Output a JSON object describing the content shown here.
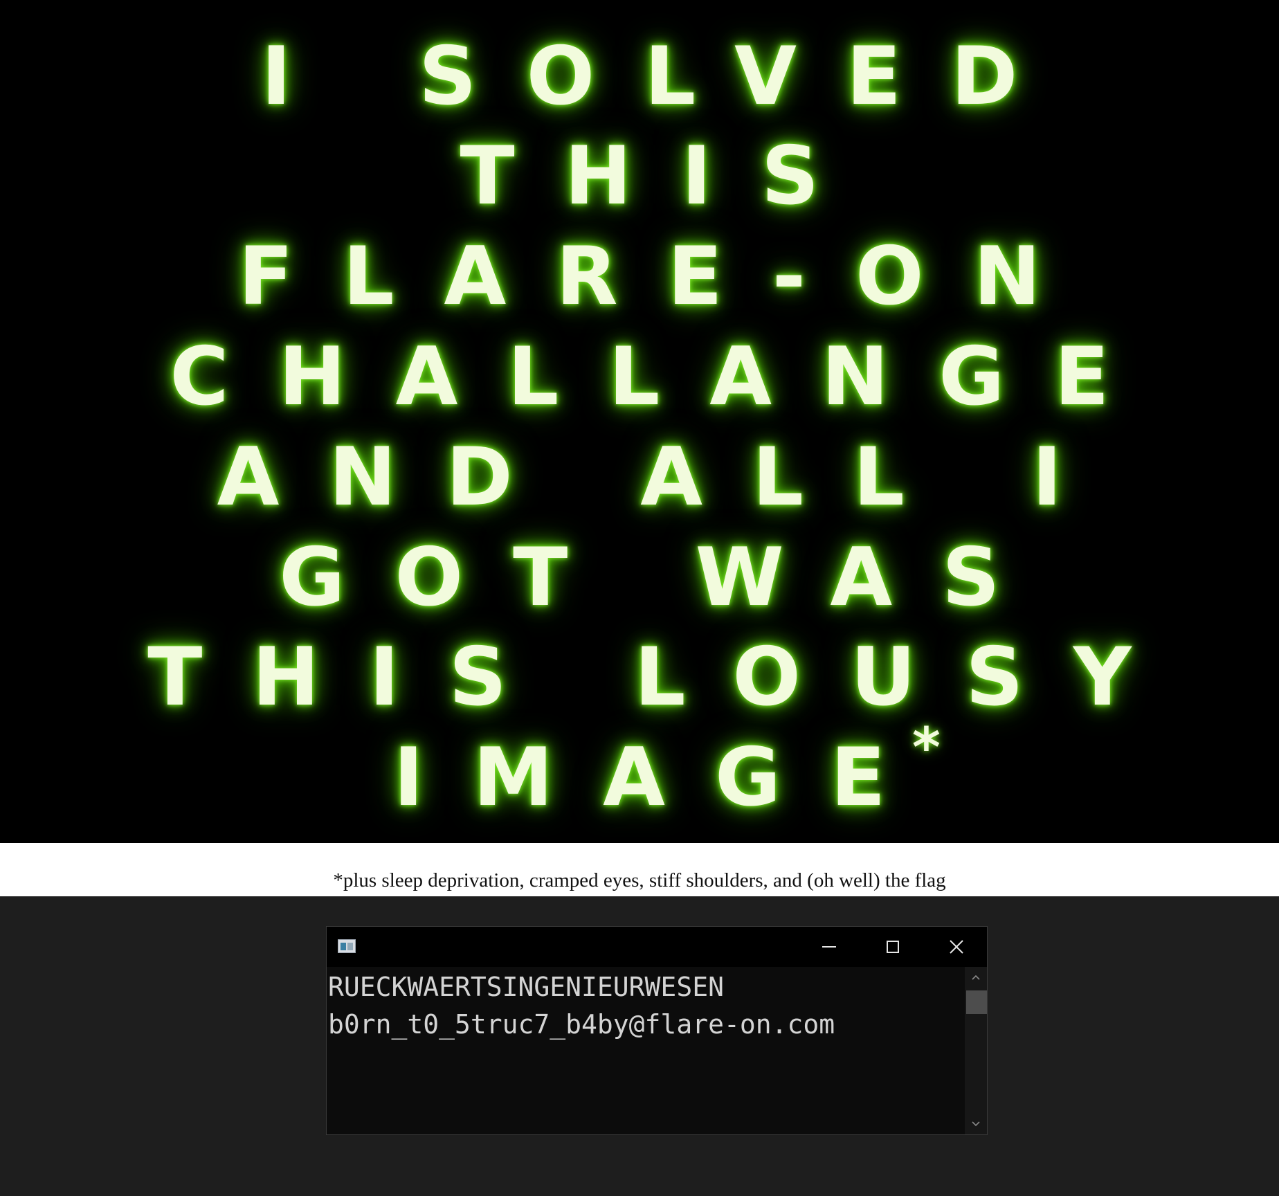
{
  "poster": {
    "lines": [
      "I SOLVED",
      "THIS",
      "FLARE-ON",
      "CHALLANGE",
      "AND ALL I",
      "GOT WAS",
      "THIS LOUSY",
      "IMAGE"
    ],
    "asterisk": "*",
    "glow_color": "#7ee82a",
    "text_color": "#f2fbdd"
  },
  "caption": "*plus sleep deprivation, cramped eyes, stiff shoulders, and (oh well) the flag",
  "console": {
    "lines": [
      "RUECKWAERTSINGENIEURWESEN",
      "b0rn_t0_5truc7_b4by@flare-on.com"
    ],
    "icons": {
      "app": "console-app-icon",
      "minimize": "minimize-icon",
      "maximize": "maximize-icon",
      "close": "close-icon",
      "scroll_up": "chevron-up-icon",
      "scroll_down": "chevron-down-icon"
    }
  }
}
